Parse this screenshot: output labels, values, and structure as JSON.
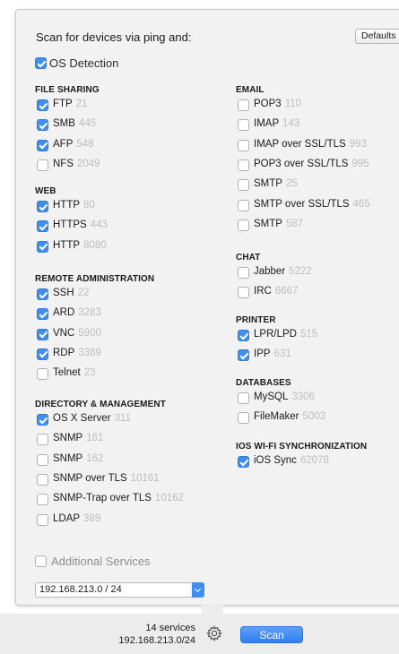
{
  "header": {
    "title": "Scan for devices via ping and:",
    "defaults_label": "Defaults"
  },
  "os_detection": {
    "label": "OS Detection",
    "checked": true
  },
  "left_column": [
    {
      "heading": "FILE SHARING",
      "items": [
        {
          "name": "FTP",
          "port": "21",
          "checked": true
        },
        {
          "name": "SMB",
          "port": "445",
          "checked": true
        },
        {
          "name": "AFP",
          "port": "548",
          "checked": true
        },
        {
          "name": "NFS",
          "port": "2049",
          "checked": false
        }
      ]
    },
    {
      "heading": "WEB",
      "items": [
        {
          "name": "HTTP",
          "port": "80",
          "checked": true
        },
        {
          "name": "HTTPS",
          "port": "443",
          "checked": true
        },
        {
          "name": "HTTP",
          "port": "8080",
          "checked": true
        }
      ]
    },
    {
      "heading": "REMOTE ADMINISTRATION",
      "items": [
        {
          "name": "SSH",
          "port": "22",
          "checked": true
        },
        {
          "name": "ARD",
          "port": "3283",
          "checked": true
        },
        {
          "name": "VNC",
          "port": "5900",
          "checked": true
        },
        {
          "name": "RDP",
          "port": "3389",
          "checked": true
        },
        {
          "name": "Telnet",
          "port": "23",
          "checked": false
        }
      ]
    },
    {
      "heading": "DIRECTORY & MANAGEMENT",
      "items": [
        {
          "name": "OS X Server",
          "port": "311",
          "checked": true
        },
        {
          "name": "SNMP",
          "port": "161",
          "checked": false
        },
        {
          "name": "SNMP",
          "port": "162",
          "checked": false
        },
        {
          "name": "SNMP over TLS",
          "port": "10161",
          "checked": false
        },
        {
          "name": "SNMP-Trap over TLS",
          "port": "10162",
          "checked": false
        },
        {
          "name": "LDAP",
          "port": "389",
          "checked": false
        }
      ]
    }
  ],
  "right_column": [
    {
      "heading": "EMAIL",
      "items": [
        {
          "name": "POP3",
          "port": "110",
          "checked": false
        },
        {
          "name": "IMAP",
          "port": "143",
          "checked": false
        },
        {
          "name": "IMAP over SSL/TLS",
          "port": "993",
          "checked": false
        },
        {
          "name": "POP3 over SSL/TLS",
          "port": "995",
          "checked": false
        },
        {
          "name": "SMTP",
          "port": "25",
          "checked": false
        },
        {
          "name": "SMTP over SSL/TLS",
          "port": "465",
          "checked": false
        },
        {
          "name": "SMTP",
          "port": "587",
          "checked": false
        }
      ]
    },
    {
      "heading": "CHAT",
      "items": [
        {
          "name": "Jabber",
          "port": "5222",
          "checked": false
        },
        {
          "name": "IRC",
          "port": "6667",
          "checked": false
        }
      ]
    },
    {
      "heading": "PRINTER",
      "items": [
        {
          "name": "LPR/LPD",
          "port": "515",
          "checked": true
        },
        {
          "name": "IPP",
          "port": "631",
          "checked": true
        }
      ]
    },
    {
      "heading": "DATABASES",
      "items": [
        {
          "name": "MySQL",
          "port": "3306",
          "checked": false
        },
        {
          "name": "FileMaker",
          "port": "5003",
          "checked": false
        }
      ]
    },
    {
      "heading": "IOS WI-FI SYNCHRONIZATION",
      "items": [
        {
          "name": "iOS Sync",
          "port": "62078",
          "checked": true
        }
      ]
    }
  ],
  "additional": {
    "label": "Additional Services",
    "checked": false
  },
  "network": {
    "value": "192.168.213.0  /  24"
  },
  "footer": {
    "services_count": "14 services",
    "subnet": "192.168.213.0/24",
    "scan_label": "Scan",
    "gear_icon": "gear-icon"
  },
  "colors": {
    "accent": "#3f8ef0",
    "port_gray": "#bdbdbd"
  }
}
